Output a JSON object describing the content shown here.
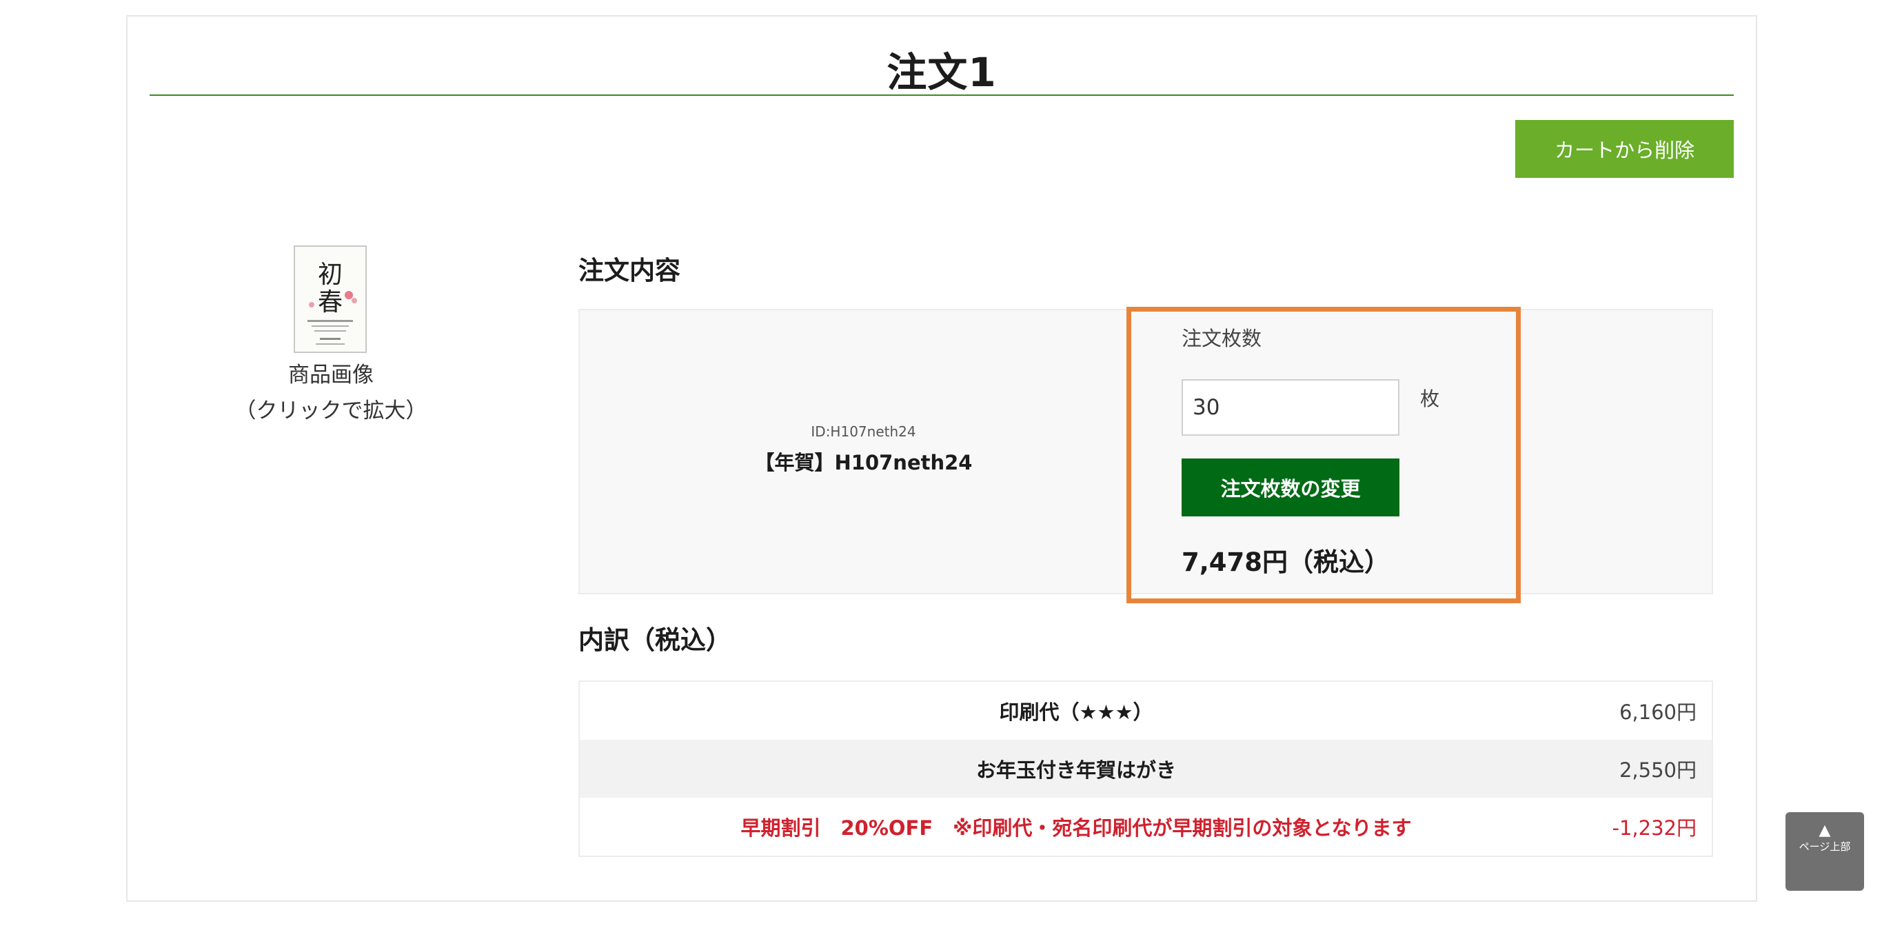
{
  "order": {
    "title": "注文1",
    "delete_button": "カートから削除"
  },
  "product": {
    "image_caption_line1": "商品画像",
    "image_caption_line2": "（クリックで拡大）",
    "image_text": "初春",
    "id_label": "ID:H107neth24",
    "name": "【年賀】H107neth24"
  },
  "order_details": {
    "heading": "注文内容",
    "quantity_label": "注文枚数",
    "quantity_value": "30",
    "quantity_unit": "枚",
    "update_button": "注文枚数の変更",
    "price": "7,478円（税込）",
    "highlight_color": "#e8843a"
  },
  "breakdown": {
    "heading": "内訳（税込）",
    "rows": [
      {
        "name": "印刷代（★★★）",
        "value": "6,160円"
      },
      {
        "name": "お年玉付き年賀はがき",
        "value": "2,550円"
      },
      {
        "name": "早期割引　20%OFF　※印刷代・宛名印刷代が早期割引の対象となります",
        "value": "-1,232円"
      }
    ]
  },
  "page_top": {
    "arrow": "▲",
    "label": "ページ上部"
  },
  "colors": {
    "accent_green": "#6aae2a",
    "dark_green": "#006a15",
    "discount_red": "#d0212e"
  }
}
